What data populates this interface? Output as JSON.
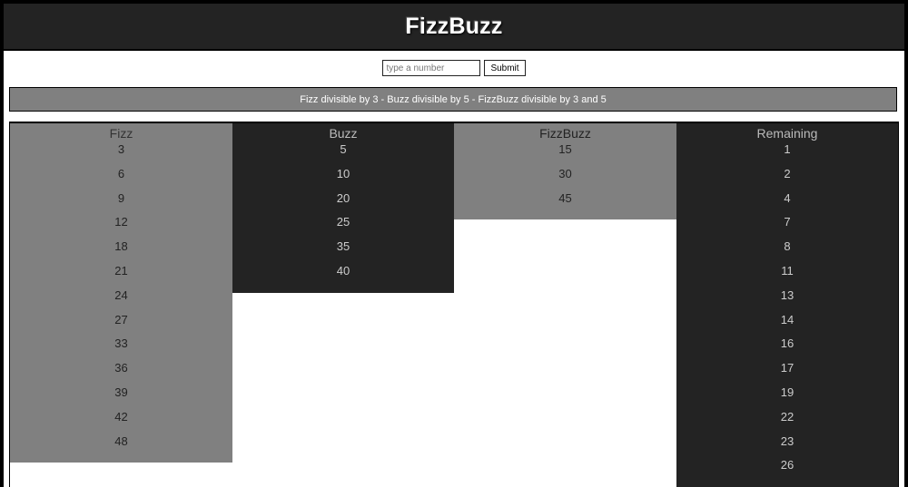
{
  "header": {
    "title": "FizzBuzz"
  },
  "form": {
    "placeholder": "type a number",
    "value": "",
    "submit_label": "Submit"
  },
  "info": {
    "text": "Fizz divisible by 3 - Buzz divisible by 5 - FizzBuzz divisible by 3 and 5"
  },
  "columns": [
    {
      "title": "Fizz",
      "items": [
        "3",
        "6",
        "9",
        "12",
        "18",
        "21",
        "24",
        "27",
        "33",
        "36",
        "39",
        "42",
        "48"
      ]
    },
    {
      "title": "Buzz",
      "items": [
        "5",
        "10",
        "20",
        "25",
        "35",
        "40"
      ]
    },
    {
      "title": "FizzBuzz",
      "items": [
        "15",
        "30",
        "45"
      ]
    },
    {
      "title": "Remaining",
      "items": [
        "1",
        "2",
        "4",
        "7",
        "8",
        "11",
        "13",
        "14",
        "16",
        "17",
        "19",
        "22",
        "23",
        "26"
      ]
    }
  ],
  "colors": {
    "dark": "#232323",
    "gray": "#808080",
    "white": "#ffffff",
    "border": "#000000"
  }
}
